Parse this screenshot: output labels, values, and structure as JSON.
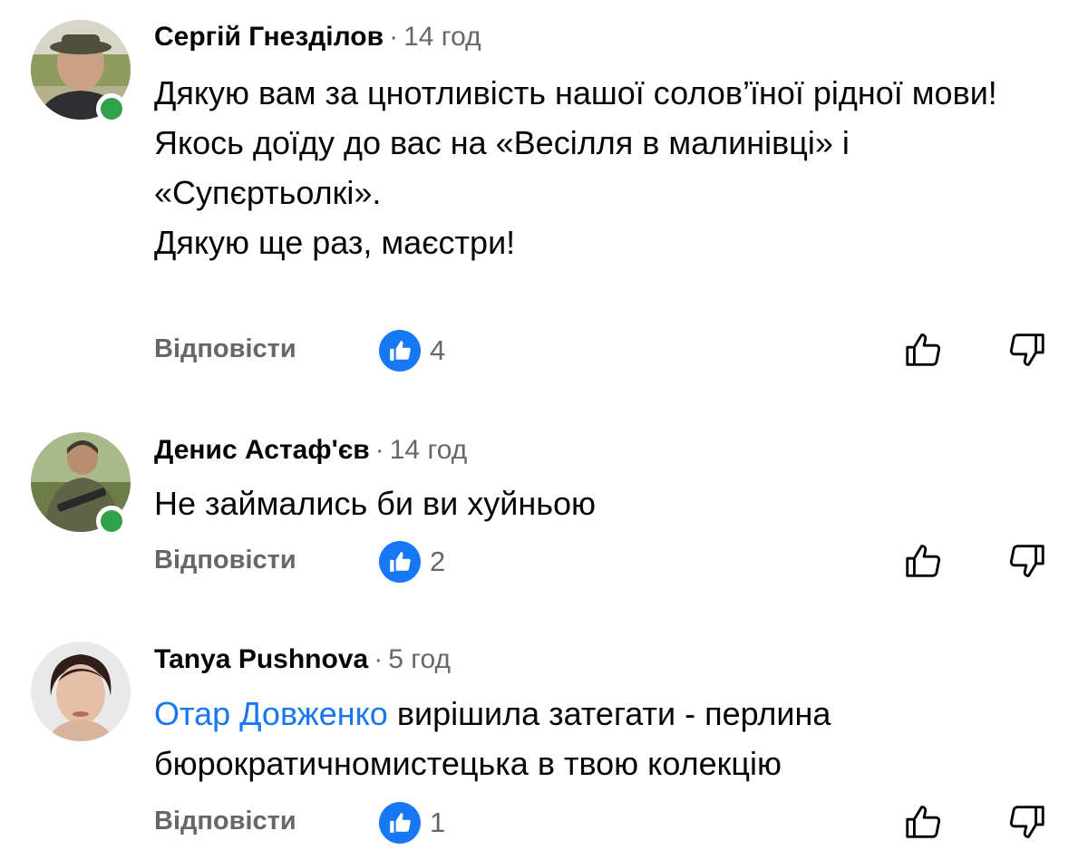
{
  "comments": [
    {
      "author": "Сергій Гнезділов",
      "separator": "·",
      "time": "14 год",
      "online": true,
      "lines": [
        "Дякую вам за цнотливість нашої солов’їної рідної мови!",
        "Якось доїду до вас на «Весілля в малинівці» і «Супєртьолкі».",
        "Дякую ще раз, маєстри!"
      ],
      "reply_label": "Відповісти",
      "like_count": "4"
    },
    {
      "author": "Денис Астаф'єв",
      "separator": "·",
      "time": "14 год",
      "online": true,
      "lines": [
        "Не займались би ви хуйньою"
      ],
      "reply_label": "Відповісти",
      "like_count": "2"
    },
    {
      "author": "Tanya Pushnova",
      "separator": "·",
      "time": "5 год",
      "online": false,
      "mention": "Отар Довженко",
      "text_after_mention": " вирішила затегати - перлина бюрократичномистецька в твою колекцію",
      "reply_label": "Відповісти",
      "like_count": "1"
    }
  ],
  "icons": {
    "like_badge": "thumbs-up-icon",
    "vote_up": "thumbs-up-outline-icon",
    "vote_down": "thumbs-down-outline-icon"
  },
  "colors": {
    "link": "#1877f2",
    "like_badge": "#1877f2",
    "secondary_text": "#65676b",
    "online": "#31a24c"
  }
}
